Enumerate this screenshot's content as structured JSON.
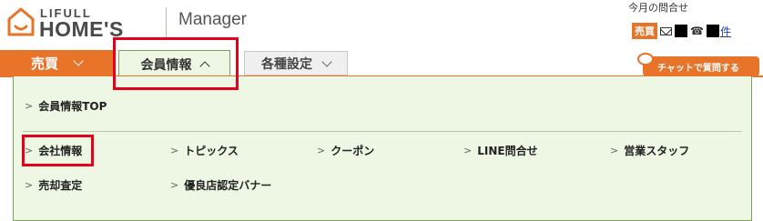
{
  "header": {
    "logo_top": "LIFULL",
    "logo_main": "HOME'S",
    "app_title": "Manager"
  },
  "inquiry": {
    "title": "今月の問合せ",
    "badge": "売買",
    "unit": "件"
  },
  "nav": {
    "tabs": [
      {
        "label": "売買",
        "state": "primary"
      },
      {
        "label": "会員情報",
        "state": "open"
      },
      {
        "label": "各種設定",
        "state": "closed"
      }
    ]
  },
  "chat_button": {
    "label": "チャットで質問する"
  },
  "menu": {
    "top_item": "会員情報TOP",
    "row1": [
      "会社情報",
      "トピックス",
      "クーポン",
      "LINE問合せ",
      "営業スタッフ"
    ],
    "row2": [
      "売却査定",
      "優良店認定バナー"
    ]
  },
  "colors": {
    "brand_orange": "#e8742a",
    "panel_green": "#eef6e4",
    "highlight_red": "#e5001c",
    "link_blue": "#1a3fb0"
  }
}
